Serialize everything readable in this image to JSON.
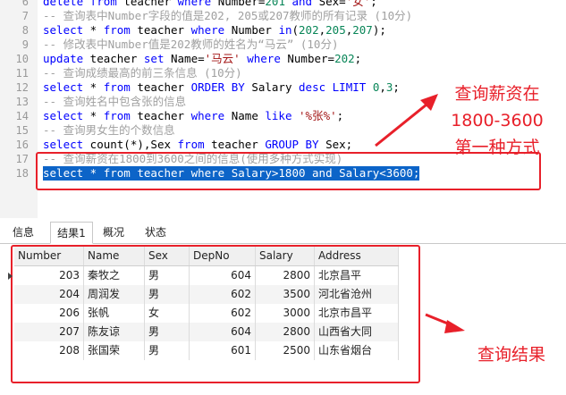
{
  "editor": {
    "lines": [
      {
        "num": "6",
        "tokens": [
          {
            "t": "delete from",
            "c": "kw"
          },
          {
            "t": " teacher ",
            "c": "id"
          },
          {
            "t": "where",
            "c": "kw"
          },
          {
            "t": " Number=",
            "c": "id"
          },
          {
            "t": "201",
            "c": "nm"
          },
          {
            "t": " and ",
            "c": "kw"
          },
          {
            "t": "Sex=",
            "c": "id"
          },
          {
            "t": "'女'",
            "c": "st"
          },
          {
            "t": ";",
            "c": "id"
          }
        ]
      },
      {
        "num": "7",
        "tokens": [
          {
            "t": "-- 查询表中Number字段的值是202, 205或207教师的所有记录 (10分)",
            "c": "cm"
          }
        ]
      },
      {
        "num": "8",
        "tokens": [
          {
            "t": "select",
            "c": "kw"
          },
          {
            "t": " * ",
            "c": "id"
          },
          {
            "t": "from",
            "c": "kw"
          },
          {
            "t": " teacher ",
            "c": "id"
          },
          {
            "t": "where",
            "c": "kw"
          },
          {
            "t": " Number ",
            "c": "id"
          },
          {
            "t": "in",
            "c": "kw"
          },
          {
            "t": "(",
            "c": "id"
          },
          {
            "t": "202",
            "c": "nm"
          },
          {
            "t": ",",
            "c": "id"
          },
          {
            "t": "205",
            "c": "nm"
          },
          {
            "t": ",",
            "c": "id"
          },
          {
            "t": "207",
            "c": "nm"
          },
          {
            "t": ");",
            "c": "id"
          }
        ]
      },
      {
        "num": "9",
        "tokens": [
          {
            "t": "-- 修改表中Number值是202教师的姓名为“马云” (10分)",
            "c": "cm"
          }
        ]
      },
      {
        "num": "10",
        "tokens": [
          {
            "t": "update",
            "c": "kw"
          },
          {
            "t": " teacher ",
            "c": "id"
          },
          {
            "t": "set",
            "c": "kw"
          },
          {
            "t": " Name=",
            "c": "id"
          },
          {
            "t": "'马云'",
            "c": "st"
          },
          {
            "t": " where ",
            "c": "kw"
          },
          {
            "t": "Number=",
            "c": "id"
          },
          {
            "t": "202",
            "c": "nm"
          },
          {
            "t": ";",
            "c": "id"
          }
        ]
      },
      {
        "num": "11",
        "tokens": [
          {
            "t": "-- 查询成绩最高的前三条信息 (10分)",
            "c": "cm"
          }
        ]
      },
      {
        "num": "12",
        "tokens": [
          {
            "t": "select",
            "c": "kw"
          },
          {
            "t": " * ",
            "c": "id"
          },
          {
            "t": "from",
            "c": "kw"
          },
          {
            "t": " teacher ",
            "c": "id"
          },
          {
            "t": "ORDER BY",
            "c": "kw"
          },
          {
            "t": " Salary ",
            "c": "id"
          },
          {
            "t": "desc LIMIT",
            "c": "kw"
          },
          {
            "t": " ",
            "c": "id"
          },
          {
            "t": "0",
            "c": "nm"
          },
          {
            "t": ",",
            "c": "id"
          },
          {
            "t": "3",
            "c": "nm"
          },
          {
            "t": ";",
            "c": "id"
          }
        ]
      },
      {
        "num": "13",
        "tokens": [
          {
            "t": "-- 查询姓名中包含张的信息",
            "c": "cm"
          }
        ]
      },
      {
        "num": "14",
        "tokens": [
          {
            "t": "select",
            "c": "kw"
          },
          {
            "t": " * ",
            "c": "id"
          },
          {
            "t": "from",
            "c": "kw"
          },
          {
            "t": " teacher ",
            "c": "id"
          },
          {
            "t": "where",
            "c": "kw"
          },
          {
            "t": " Name ",
            "c": "id"
          },
          {
            "t": "like",
            "c": "kw"
          },
          {
            "t": " ",
            "c": "id"
          },
          {
            "t": "'%张%'",
            "c": "st"
          },
          {
            "t": ";",
            "c": "id"
          }
        ]
      },
      {
        "num": "15",
        "tokens": [
          {
            "t": "-- 查询男女生的个数信息",
            "c": "cm"
          }
        ]
      },
      {
        "num": "16",
        "tokens": [
          {
            "t": "select",
            "c": "kw"
          },
          {
            "t": " count(*),Sex ",
            "c": "id"
          },
          {
            "t": "from",
            "c": "kw"
          },
          {
            "t": " teacher ",
            "c": "id"
          },
          {
            "t": "GROUP BY",
            "c": "kw"
          },
          {
            "t": " Sex;",
            "c": "id"
          }
        ]
      },
      {
        "num": "17",
        "tokens": [
          {
            "t": "-- 查询薪资在1800到3600之间的信息(使用多种方式实现)",
            "c": "cm"
          }
        ]
      },
      {
        "num": "18",
        "selected": true,
        "tokens": [
          {
            "t": "select * from teacher where Salary>1800 and Salary<3600;",
            "c": "id"
          }
        ]
      }
    ]
  },
  "annotations": {
    "top_note": [
      "查询薪资在",
      "1800-3600",
      "第一种方式"
    ],
    "bottom_note": "查询结果",
    "color": "#e8202a"
  },
  "tabs": [
    "信息",
    "结果1",
    "概况",
    "状态"
  ],
  "active_tab": "结果1",
  "results": {
    "columns": [
      "Number",
      "Name",
      "Sex",
      "DepNo",
      "Salary",
      "Address"
    ],
    "rows": [
      [
        "203",
        "秦牧之",
        "男",
        "604",
        "2800",
        "北京昌平"
      ],
      [
        "204",
        "周润发",
        "男",
        "602",
        "3500",
        "河北省沧州"
      ],
      [
        "206",
        "张帆",
        "女",
        "602",
        "3000",
        "北京市昌平"
      ],
      [
        "207",
        "陈友谅",
        "男",
        "604",
        "2800",
        "山西省大同"
      ],
      [
        "208",
        "张国荣",
        "男",
        "601",
        "2500",
        "山东省烟台"
      ]
    ]
  }
}
